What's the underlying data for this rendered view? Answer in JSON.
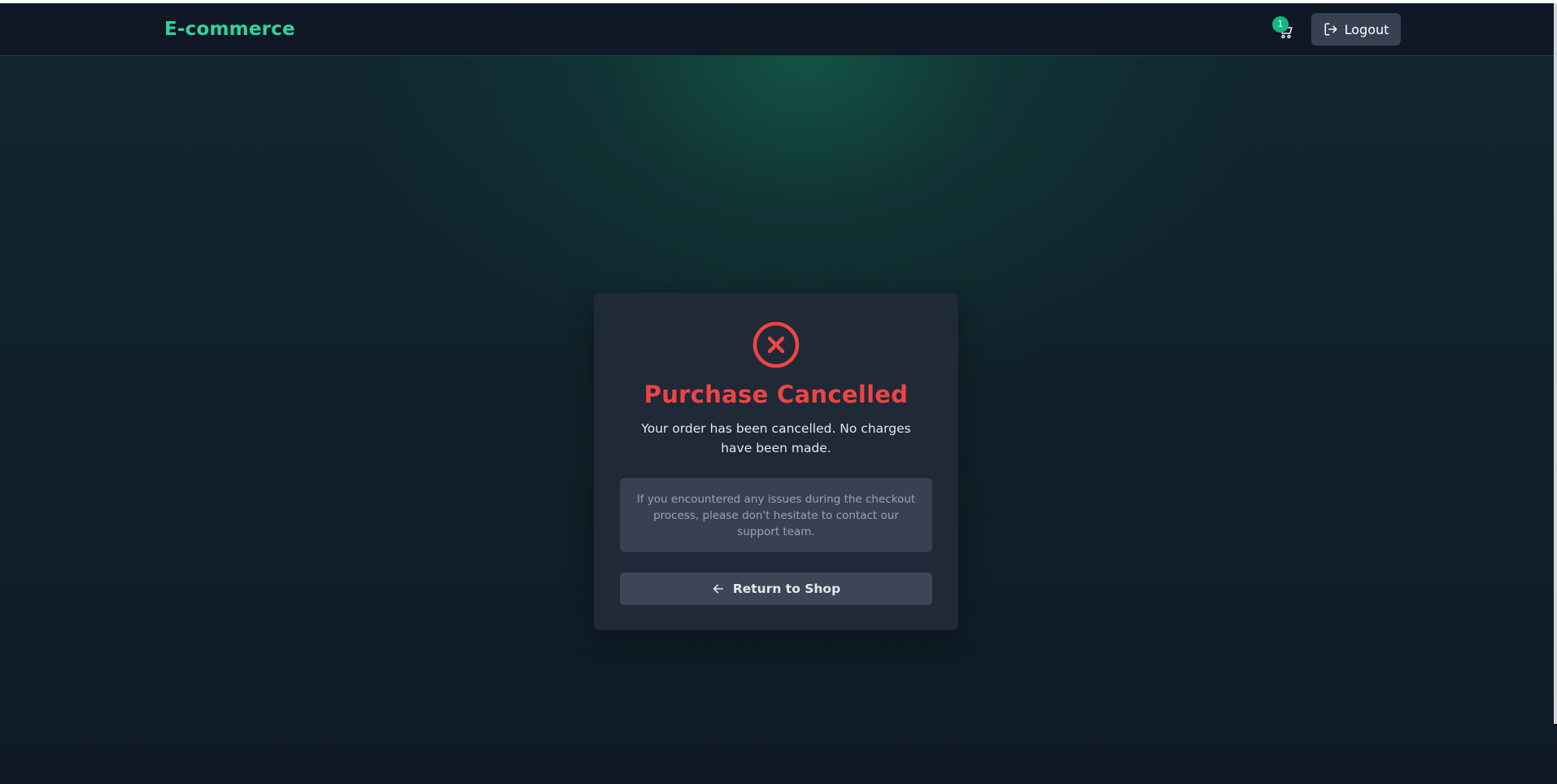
{
  "header": {
    "brand": "E-commerce",
    "cart_count": "1",
    "logout_label": "Logout"
  },
  "card": {
    "title": "Purchase Cancelled",
    "message": "Your order has been cancelled. No charges have been made.",
    "info": "If you encountered any issues during the checkout process, please don't hesitate to contact our support team.",
    "return_label": "Return to Shop"
  },
  "icons": {
    "cart": "cart-icon",
    "logout": "logout-icon",
    "cancel": "x-circle-icon",
    "back": "arrow-left-icon"
  },
  "colors": {
    "brand": "#34d399",
    "danger": "#ef4444",
    "badge": "#10b981",
    "card_bg": "#1f2937",
    "button_bg": "#374151"
  }
}
